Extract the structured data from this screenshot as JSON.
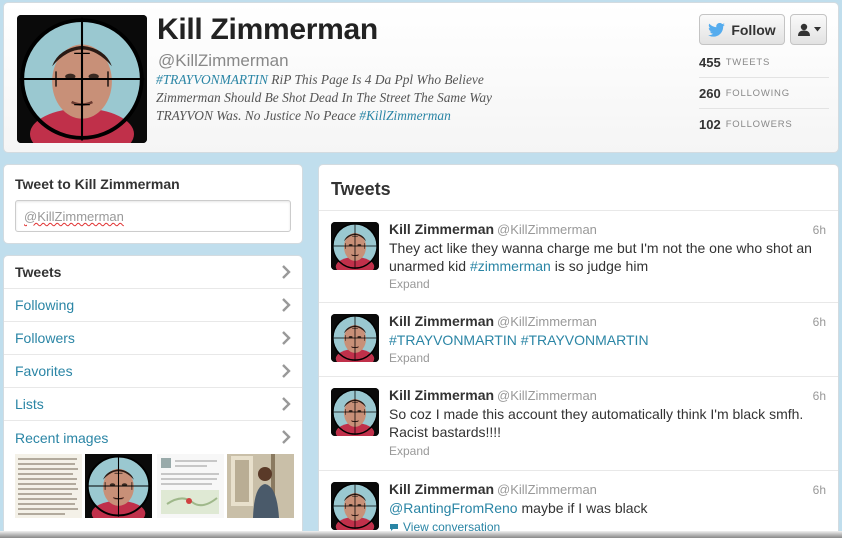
{
  "profile": {
    "name": "Kill Zimmerman",
    "handle": "@KillZimmerman",
    "bio": {
      "tag1": "#TRAYVONMARTIN",
      "text": " RiP This Page Is 4 Da Ppl Who Believe Zimmerman Should Be Shot Dead In The Street The Same Way TRAYVON Was. No Justice No Peace ",
      "tag2": "#KillZimmerman"
    },
    "avatar_icon": "profile-photo-crosshair",
    "follow_label": "Follow",
    "stats": [
      {
        "value": "455",
        "label": "TWEETS"
      },
      {
        "value": "260",
        "label": "FOLLOWING"
      },
      {
        "value": "102",
        "label": "FOLLOWERS"
      }
    ]
  },
  "tweet_to": {
    "title": "Tweet to Kill Zimmerman",
    "value": "@KillZimmerman"
  },
  "nav": {
    "items": [
      {
        "label": "Tweets"
      },
      {
        "label": "Following"
      },
      {
        "label": "Followers"
      },
      {
        "label": "Favorites"
      },
      {
        "label": "Lists"
      },
      {
        "label": "Recent images"
      }
    ]
  },
  "tweets": {
    "title": "Tweets",
    "items": [
      {
        "name": "Kill Zimmerman",
        "handle": "@KillZimmerman",
        "time": "6h",
        "text_a": "They act like they wanna charge me but I'm not the one who shot an unarmed kid ",
        "link_a": "#zimmerman",
        "text_b": " is so judge him",
        "expand": "Expand"
      },
      {
        "name": "Kill Zimmerman",
        "handle": "@KillZimmerman",
        "time": "6h",
        "link_a": "#TRAYVONMARTIN #TRAYVONMARTIN",
        "expand": "Expand"
      },
      {
        "name": "Kill Zimmerman",
        "handle": "@KillZimmerman",
        "time": "6h",
        "text_a": "So coz I made this account they automatically think I'm black smfh. Racist bastards!!!!",
        "expand": "Expand"
      },
      {
        "name": "Kill Zimmerman",
        "handle": "@KillZimmerman",
        "time": "6h",
        "link_a": "@RantingFromReno",
        "text_b": " maybe if I was black",
        "conversation": "View conversation"
      }
    ]
  },
  "colors": {
    "background": "#c0deed",
    "link": "#2a85a5",
    "twitter_bird": "#55acee"
  }
}
